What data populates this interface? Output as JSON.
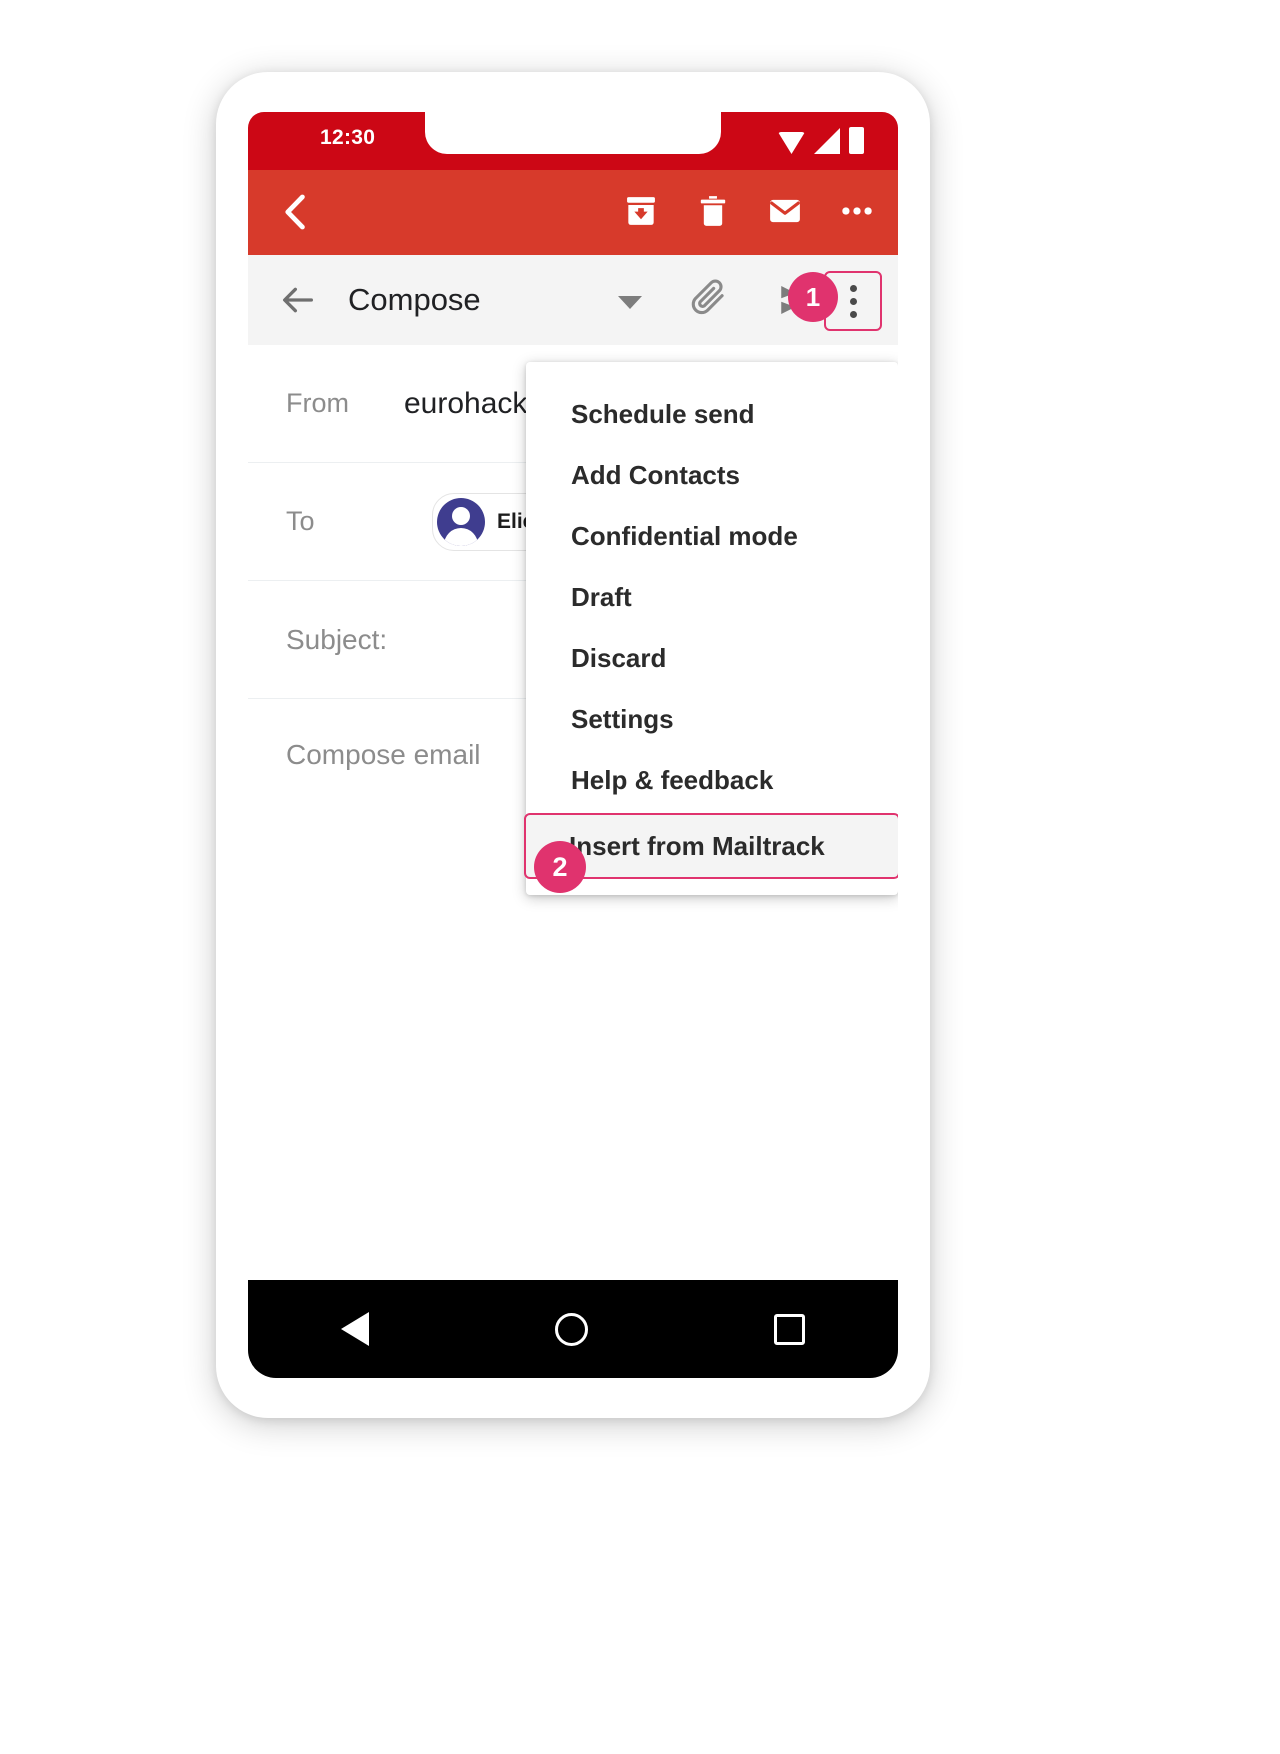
{
  "status_bar": {
    "time": "12:30",
    "icons": [
      "wifi-icon",
      "signal-icon",
      "battery-icon"
    ]
  },
  "red_toolbar": {
    "back_icon": "back-chevron-icon",
    "actions": [
      {
        "name": "archive-icon",
        "label": "Archive"
      },
      {
        "name": "trash-icon",
        "label": "Delete"
      },
      {
        "name": "mail-icon",
        "label": "Mark as unread"
      },
      {
        "name": "more-horizontal-icon",
        "label": "More options"
      }
    ]
  },
  "compose_header": {
    "back_icon": "arrow-left-icon",
    "title": "Compose",
    "caret_icon": "chevron-down-icon",
    "attach_icon": "paperclip-icon",
    "mailtrack_icon": "mailtrack-icon",
    "overflow_icon": "three-dot-vertical-icon",
    "step_badge_1": "1"
  },
  "form": {
    "from": {
      "label": "From",
      "value": "eurohack"
    },
    "to": {
      "label": "To",
      "chip_name": "Eliezer"
    },
    "subject": {
      "label": "Subject:",
      "placeholder": ""
    },
    "body": {
      "placeholder": "Compose email"
    }
  },
  "overflow_menu": {
    "items": [
      {
        "label": "Schedule send",
        "highlighted": false
      },
      {
        "label": "Add Contacts",
        "highlighted": false
      },
      {
        "label": "Confidential mode",
        "highlighted": false
      },
      {
        "label": "Draft",
        "highlighted": false
      },
      {
        "label": "Discard",
        "highlighted": false
      },
      {
        "label": "Settings",
        "highlighted": false
      },
      {
        "label": "Help & feedback",
        "highlighted": false
      },
      {
        "label": "Insert from Mailtrack",
        "highlighted": true
      }
    ],
    "step_badge_2": "2"
  },
  "nav_bar": {
    "back": "nav-back-icon",
    "home": "nav-home-icon",
    "recent": "nav-recent-icon"
  },
  "colors": {
    "status_red": "#cc0715",
    "toolbar_red": "#d73a2b",
    "accent_pink": "#e0336e",
    "avatar_purple": "#3f3d8f",
    "header_grey": "#f4f4f4"
  }
}
